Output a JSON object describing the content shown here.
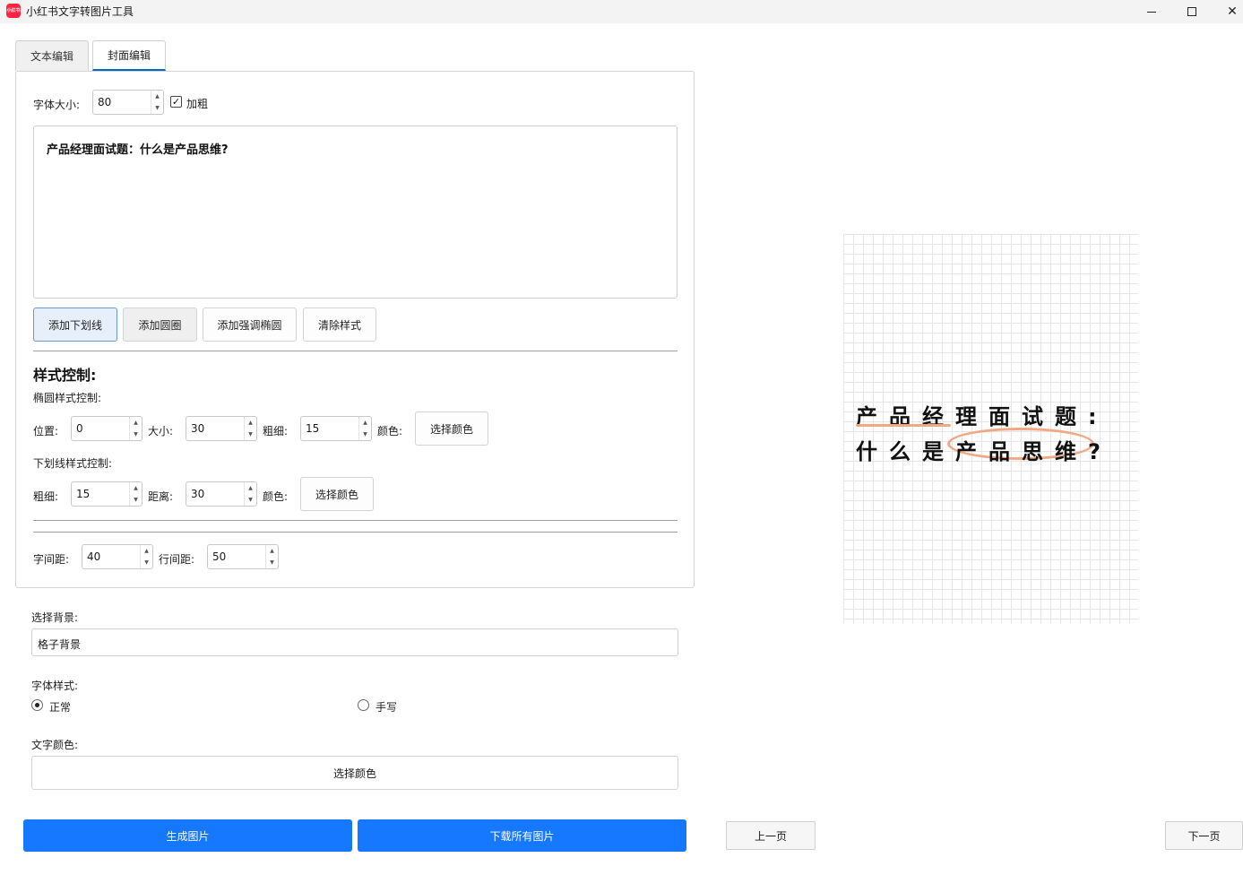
{
  "window": {
    "title": "小红书文字转图片工具",
    "icon_text": "小红书"
  },
  "tabs": [
    {
      "label": "文本编辑",
      "active": false
    },
    {
      "label": "封面编辑",
      "active": true
    }
  ],
  "cover_editor": {
    "font_size_label": "字体大小:",
    "font_size_value": "80",
    "bold_label": "加粗",
    "bold_checked": true,
    "text_content": "产品经理面试题：什么是产品思维?",
    "buttons": {
      "add_underline": "添加下划线",
      "add_circle": "添加圆圈",
      "add_emphasis_ellipse": "添加强调椭圆",
      "clear_style": "清除样式"
    },
    "style_control_title": "样式控制:",
    "ellipse_section_label": "椭圆样式控制:",
    "ellipse": {
      "position_label": "位置:",
      "position_value": "0",
      "size_label": "大小:",
      "size_value": "30",
      "thickness_label": "粗细:",
      "thickness_value": "15",
      "color_label": "颜色:",
      "color_button": "选择颜色"
    },
    "underline_section_label": "下划线样式控制:",
    "underline": {
      "thickness_label": "粗细:",
      "thickness_value": "15",
      "distance_label": "距离:",
      "distance_value": "30",
      "color_label": "颜色:",
      "color_button": "选择颜色"
    },
    "spacing": {
      "char_spacing_label": "字间距:",
      "char_spacing_value": "40",
      "line_spacing_label": "行间距:",
      "line_spacing_value": "50"
    }
  },
  "background": {
    "label": "选择背景:",
    "value": "格子背景"
  },
  "font_style": {
    "label": "字体样式:",
    "options": [
      {
        "label": "正常",
        "checked": true
      },
      {
        "label": "手写",
        "checked": false
      }
    ]
  },
  "text_color": {
    "label": "文字颜色:",
    "button": "选择颜色"
  },
  "actions": {
    "generate": "生成图片",
    "download_all": "下载所有图片",
    "prev_page": "上一页",
    "next_page": "下一页"
  },
  "preview": {
    "line1": "产品经理面试题:",
    "line2": "什么是产品思维?",
    "accent_color": "#f2a882",
    "background": "grid"
  },
  "colors": {
    "primary": "#1677ff",
    "tab_underline": "#0067c0",
    "app_icon": "#ff2442"
  }
}
